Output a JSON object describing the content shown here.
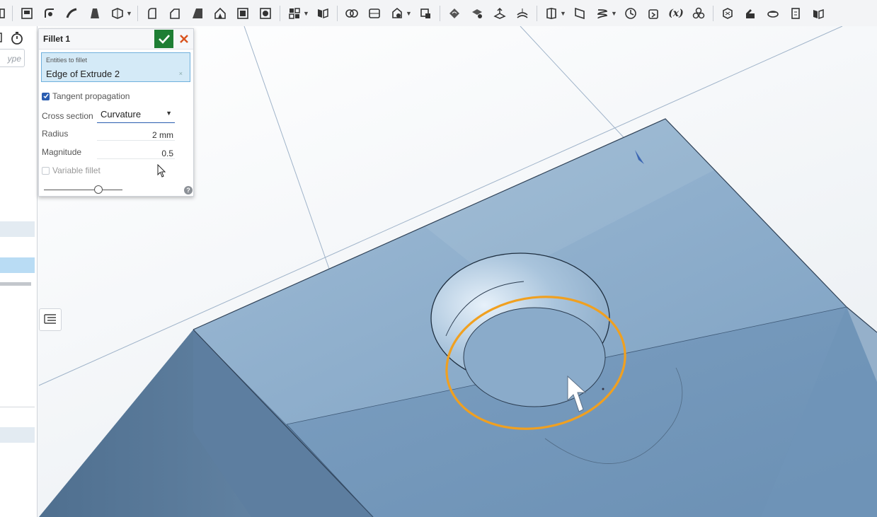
{
  "toolbar": {
    "tools": [
      "sketch-icon",
      "fillet-icon",
      "sweep-icon",
      "loft-icon",
      "thicken-icon",
      "revolve-icon",
      "chamfer-icon",
      "draft-icon",
      "rib-icon",
      "shell-icon",
      "hole-icon",
      "pattern-icon",
      "mirror-icon",
      "boolean-icon",
      "split-icon",
      "transform-icon",
      "delete-part-icon",
      "modify-fillet-icon",
      "move-face-icon",
      "replace-face-icon",
      "offset-surface-icon",
      "plane-icon",
      "mate-connector-icon",
      "helix-icon",
      "history-icon",
      "insert-icon",
      "variable-icon",
      "assembly-icon",
      "section-view-icon",
      "measure-icon",
      "appearance-icon",
      "rollback-icon",
      "render-icon"
    ],
    "variable_label": "(x)"
  },
  "left_panel": {
    "search_placeholder": "ype"
  },
  "fillet_panel": {
    "title": "Fillet 1",
    "entities_label": "Entities to fillet",
    "entities_value": "Edge of Extrude 2",
    "tangent_propagation": {
      "label": "Tangent propagation",
      "checked": true
    },
    "cross_section": {
      "label": "Cross section",
      "value": "Curvature"
    },
    "radius": {
      "label": "Radius",
      "value": "2 mm"
    },
    "magnitude": {
      "label": "Magnitude",
      "value": "0.5"
    },
    "variable_fillet": {
      "label": "Variable fillet",
      "checked": false
    },
    "help": "?"
  },
  "colors": {
    "accent_blue": "#2a5db0",
    "confirm_green": "#1e7e34",
    "cancel_orange": "#d9531e",
    "highlight_edge": "#f0a020",
    "part_blue": "#8fb1cf"
  }
}
